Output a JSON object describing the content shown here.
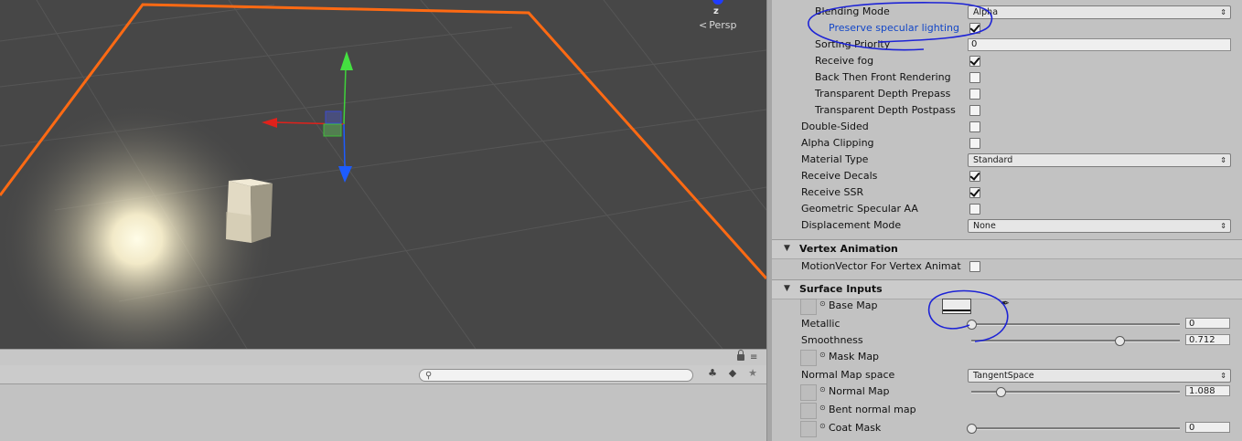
{
  "scene": {
    "axis_label": "z",
    "persp_label": "Persp"
  },
  "inspector": {
    "rows_top": [
      {
        "id": "blending-mode",
        "label": "Blending Mode",
        "indent": 2,
        "kind": "dropdown",
        "value": "Alpha"
      },
      {
        "id": "preserve-specular-lighting",
        "label": "Preserve specular lighting",
        "indent": 3,
        "kind": "check",
        "checked": true,
        "highlight": true
      },
      {
        "id": "sorting-priority",
        "label": "Sorting Priority",
        "indent": 2,
        "kind": "number",
        "value": "0"
      },
      {
        "id": "receive-fog",
        "label": "Receive fog",
        "indent": 2,
        "kind": "check",
        "checked": true
      },
      {
        "id": "back-then-front-rendering",
        "label": "Back Then Front Rendering",
        "indent": 2,
        "kind": "check",
        "checked": false
      },
      {
        "id": "transparent-depth-prepass",
        "label": "Transparent Depth Prepass",
        "indent": 2,
        "kind": "check",
        "checked": false
      },
      {
        "id": "transparent-depth-postpass",
        "label": "Transparent Depth Postpass",
        "indent": 2,
        "kind": "check",
        "checked": false
      },
      {
        "id": "double-sided",
        "label": "Double-Sided",
        "indent": 1,
        "kind": "check",
        "checked": false
      },
      {
        "id": "alpha-clipping",
        "label": "Alpha Clipping",
        "indent": 1,
        "kind": "check",
        "checked": false
      },
      {
        "id": "material-type",
        "label": "Material Type",
        "indent": 1,
        "kind": "dropdown",
        "value": "Standard"
      },
      {
        "id": "receive-decals",
        "label": "Receive Decals",
        "indent": 1,
        "kind": "check",
        "checked": true
      },
      {
        "id": "receive-ssr",
        "label": "Receive SSR",
        "indent": 1,
        "kind": "check",
        "checked": true
      },
      {
        "id": "geometric-specular-aa",
        "label": "Geometric Specular AA",
        "indent": 1,
        "kind": "check",
        "checked": false
      },
      {
        "id": "displacement-mode",
        "label": "Displacement Mode",
        "indent": 1,
        "kind": "dropdown",
        "value": "None"
      }
    ],
    "vertex_animation": {
      "title": "Vertex Animation",
      "motion_vector_label": "MotionVector For Vertex Animat",
      "motion_vector_checked": false
    },
    "surface_inputs": {
      "title": "Surface Inputs",
      "base_map_label": "Base Map",
      "metallic_label": "Metallic",
      "metallic_value": "0",
      "smoothness_label": "Smoothness",
      "smoothness_value": "0.712",
      "mask_map_label": "Mask Map",
      "normal_map_space_label": "Normal Map space",
      "normal_map_space_value": "TangentSpace",
      "normal_map_label": "Normal Map",
      "normal_map_value": "1.088",
      "bent_normal_label": "Bent normal map",
      "coat_mask_label": "Coat Mask",
      "coat_mask_value": "0"
    },
    "slider_levels": {
      "metallic": 0,
      "smoothness": 0.712,
      "normal_map_scale": 0.14,
      "coat_mask": 0
    }
  },
  "colors": {
    "selection_outline": "#ff6a13",
    "annotation_ink": "#1d23d6",
    "x_axis": "#e0211b",
    "y_axis": "#3fd23b",
    "z_axis": "#1d5cff"
  },
  "icons": [
    "lock-icon",
    "menu-icon",
    "search-icon",
    "effects-icon",
    "label-icon",
    "favorite-icon",
    "target-icon",
    "eyedropper-icon",
    "foldout-arrow-icon",
    "dropdown-arrows-icon"
  ]
}
